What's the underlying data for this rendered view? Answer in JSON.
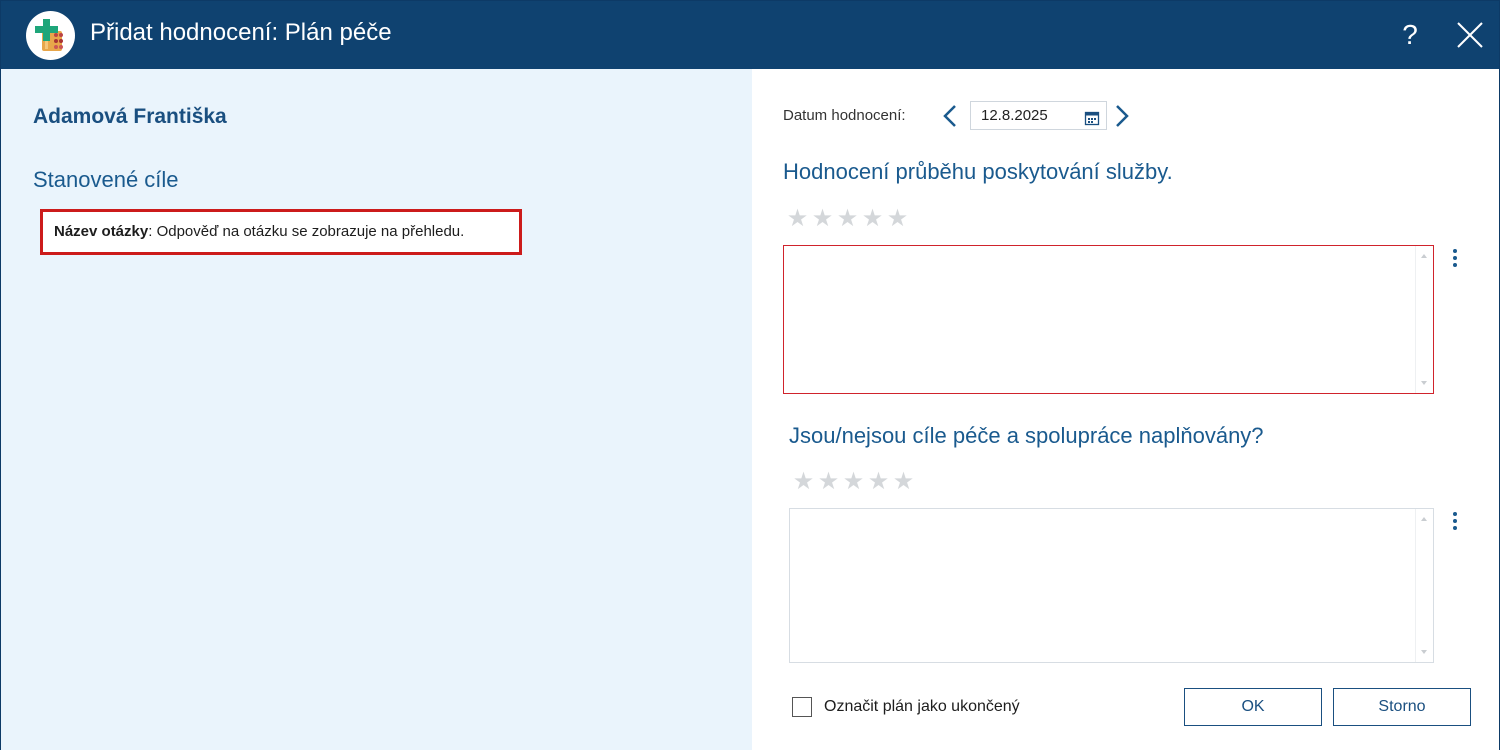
{
  "window": {
    "title": "Přidat hodnocení: Plán péče",
    "help_label": "?"
  },
  "left": {
    "patient_name": "Adamová Františka",
    "section_title": "Stanovené cíle",
    "question": {
      "label": "Název otázky",
      "separator": ": ",
      "text": "Odpověď na otázku se zobrazuje na přehledu."
    }
  },
  "right": {
    "date_label": "Datum hodnocení:",
    "date_value": "12.8.2025",
    "questions": [
      {
        "heading": "Hodnocení průběhu poskytování služby.",
        "rating": 0,
        "max_rating": 5,
        "answer": "",
        "invalid": true
      },
      {
        "heading": "Jsou/nejsou cíle péče a spolupráce naplňovány?",
        "rating": 0,
        "max_rating": 5,
        "answer": "",
        "invalid": false
      }
    ],
    "finish_checkbox_label": "Označit plán jako ukončený",
    "finish_checked": false,
    "ok_label": "OK",
    "cancel_label": "Storno"
  },
  "colors": {
    "titlebar": "#0f4270",
    "left_panel_bg": "#eaf4fc",
    "accent_text": "#1a5a8e",
    "error_border": "#cc1b1b",
    "star_empty": "#d4d7da"
  },
  "icons": [
    "app-logo-icon",
    "help-icon",
    "close-icon",
    "chevron-left-icon",
    "calendar-icon",
    "chevron-right-icon",
    "star-icon",
    "kebab-menu-icon",
    "checkbox-icon"
  ]
}
